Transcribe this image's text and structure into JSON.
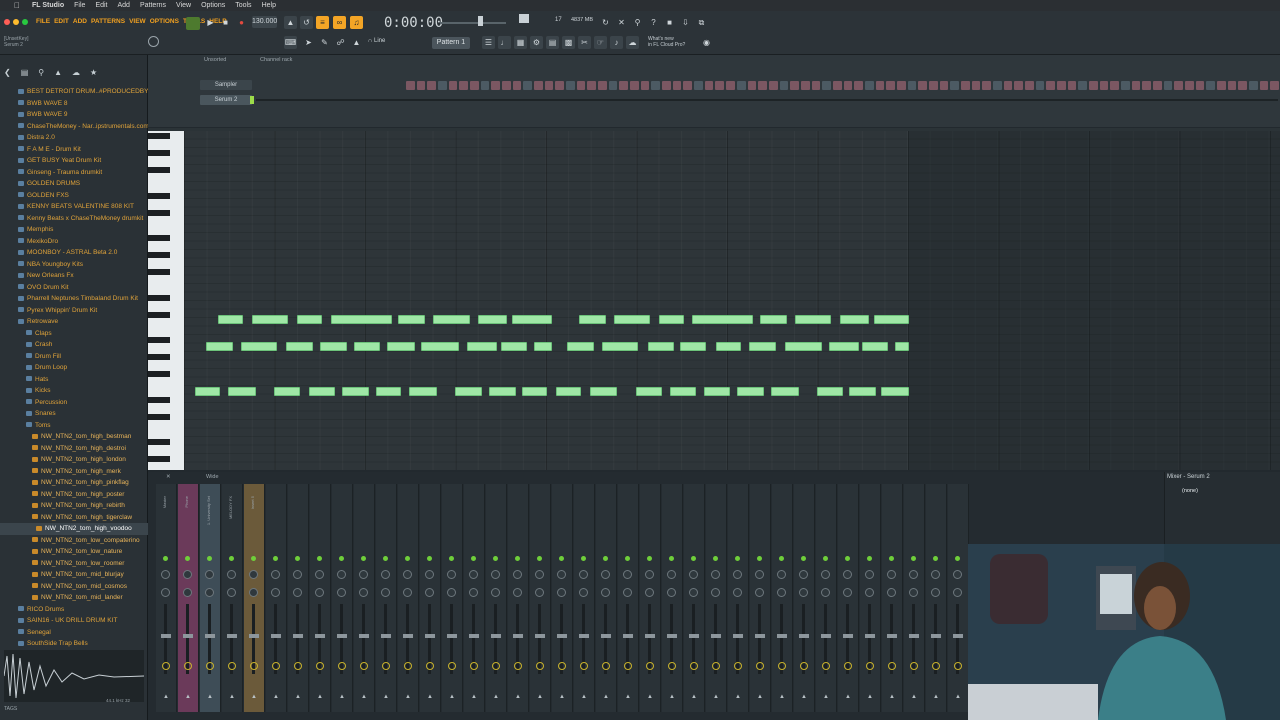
{
  "menubar": {
    "app_name": "FL Studio",
    "items": [
      "File",
      "Edit",
      "Add",
      "Patterns",
      "View",
      "Options",
      "Tools",
      "Help"
    ]
  },
  "toolbar": {
    "inner_menu": [
      "FILE",
      "EDIT",
      "ADD",
      "PATTERNS",
      "VIEW",
      "OPTIONS",
      "TOOLS",
      "HELP"
    ],
    "tempo": "130.000",
    "time": "0:00:00",
    "pattern": "Pattern 1",
    "cpu": "17",
    "memory": "4837 MB",
    "news": [
      "What's new",
      "in FL Cloud Pro?"
    ],
    "snap": "Line",
    "hint": [
      "[UnsetKey]",
      "Serum 2"
    ]
  },
  "browser": {
    "items": [
      {
        "label": "BEST DETROIT DRUM..#PRODUCEDBYAVEN",
        "type": "folder"
      },
      {
        "label": "BWB WAVE 8",
        "type": "folder"
      },
      {
        "label": "BWB WAVE 9",
        "type": "folder"
      },
      {
        "label": "ChaseTheMoney - Nar..ipstrumentals.com",
        "type": "folder"
      },
      {
        "label": "Distra 2.0",
        "type": "folder"
      },
      {
        "label": "F A M E - Drum Kit",
        "type": "folder"
      },
      {
        "label": "GET BUSY Yeat Drum Kit",
        "type": "folder"
      },
      {
        "label": "Ginseng - Trauma drumkit",
        "type": "folder"
      },
      {
        "label": "GOLDEN DRUMS",
        "type": "folder"
      },
      {
        "label": "GOLDEN FXS",
        "type": "folder"
      },
      {
        "label": "KENNY BEATS VALENTINE 808 KIT",
        "type": "folder"
      },
      {
        "label": "Kenny Beats x ChaseTheMoney drumkit",
        "type": "folder"
      },
      {
        "label": "Memphis",
        "type": "folder"
      },
      {
        "label": "MexikoDro",
        "type": "folder"
      },
      {
        "label": "MOONBOY - ASTRAL Beta 2.0",
        "type": "folder"
      },
      {
        "label": "NBA Youngboy Kits",
        "type": "folder"
      },
      {
        "label": "New Orleans Fx",
        "type": "folder"
      },
      {
        "label": "OVO Drum Kit",
        "type": "folder"
      },
      {
        "label": "Pharrell Neptunes Timbaland Drum Kit",
        "type": "folder"
      },
      {
        "label": "Pyrex Whippin' Drum Kit",
        "type": "folder"
      },
      {
        "label": "Retrowave",
        "type": "folder"
      },
      {
        "label": "Claps",
        "type": "subfolder"
      },
      {
        "label": "Crash",
        "type": "subfolder"
      },
      {
        "label": "Drum Fill",
        "type": "subfolder"
      },
      {
        "label": "Drum Loop",
        "type": "subfolder"
      },
      {
        "label": "Hats",
        "type": "subfolder"
      },
      {
        "label": "Kicks",
        "type": "subfolder"
      },
      {
        "label": "Percussion",
        "type": "subfolder"
      },
      {
        "label": "Snares",
        "type": "subfolder"
      },
      {
        "label": "Toms",
        "type": "subfolder"
      },
      {
        "label": "NW_NTN2_tom_high_bestman",
        "type": "file"
      },
      {
        "label": "NW_NTN2_tom_high_destroi",
        "type": "file"
      },
      {
        "label": "NW_NTN2_tom_high_london",
        "type": "file"
      },
      {
        "label": "NW_NTN2_tom_high_merk",
        "type": "file"
      },
      {
        "label": "NW_NTN2_tom_high_pinkflag",
        "type": "file"
      },
      {
        "label": "NW_NTN2_tom_high_poster",
        "type": "file"
      },
      {
        "label": "NW_NTN2_tom_high_rebirth",
        "type": "file"
      },
      {
        "label": "NW_NTN2_tom_high_tigerclaw",
        "type": "file"
      },
      {
        "label": "NW_NTN2_tom_high_voodoo",
        "type": "file",
        "selected": true
      },
      {
        "label": "NW_NTN2_tom_low_compaterino",
        "type": "file"
      },
      {
        "label": "NW_NTN2_tom_low_nature",
        "type": "file"
      },
      {
        "label": "NW_NTN2_tom_low_roomer",
        "type": "file"
      },
      {
        "label": "NW_NTN2_tom_mid_blurjay",
        "type": "file"
      },
      {
        "label": "NW_NTN2_tom_mid_cosmos",
        "type": "file"
      },
      {
        "label": "NW_NTN2_tom_mid_lander",
        "type": "file"
      },
      {
        "label": "RICO Drums",
        "type": "folder"
      },
      {
        "label": "SAIN16 - UK DRILL DRUM KIT",
        "type": "folder"
      },
      {
        "label": "Senegal",
        "type": "folder"
      },
      {
        "label": "SouthSide Trap Bells",
        "type": "folder"
      },
      {
        "label": "The Life Of Pablo Drum Kit",
        "type": "folder"
      }
    ],
    "footer": "TAGS",
    "sample_info": "44.1 kHz 32"
  },
  "channel_rack": {
    "filter": "Unsorted",
    "title": "Channel rack",
    "channels": [
      "Sampler",
      "Serum 2"
    ]
  },
  "mixer": {
    "view": "Wide",
    "named_tracks": [
      "Master",
      "Phone",
      "1. University Set",
      "MELODY FX",
      "Insert 5"
    ],
    "selector_title": "Mixer - Serum 2",
    "selector_slot": "(none)"
  },
  "colors": {
    "note_fill": "#9fe7a6",
    "accent": "#f3a526",
    "step_on": "#7b5762"
  },
  "icons": [
    "play-icon",
    "stop-icon",
    "record-icon",
    "metronome-icon",
    "folder-icon",
    "mixer-icon",
    "piano-roll-icon",
    "channel-rack-icon",
    "playlist-icon",
    "help-icon"
  ]
}
